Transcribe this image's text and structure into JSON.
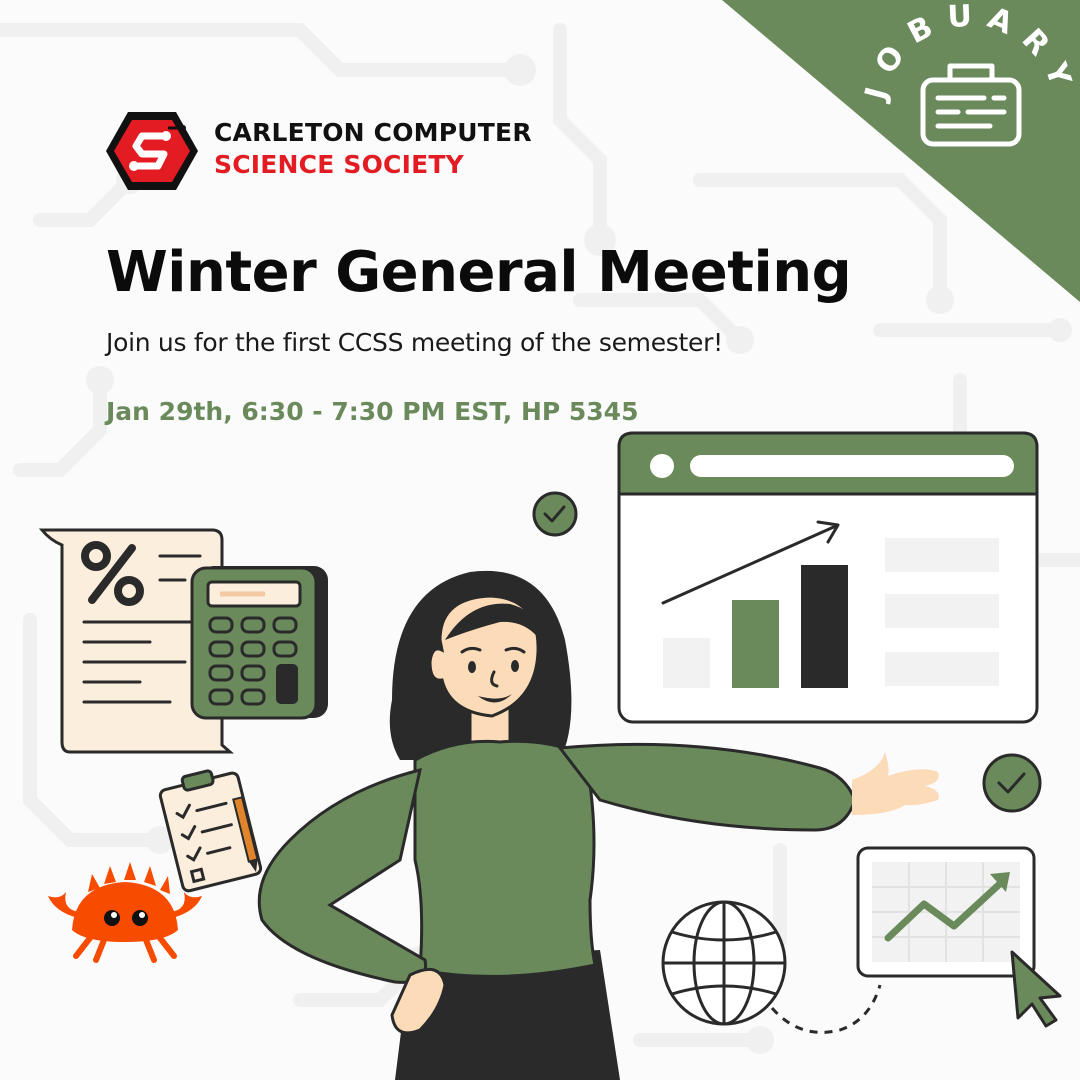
{
  "organization": {
    "name_line1": "CARLETON COMPUTER",
    "name_line2": "SCIENCE SOCIETY",
    "brand_color": "#e31b23"
  },
  "badge": {
    "label": "JOBUARY",
    "icon": "briefcase-icon",
    "background_color": "#6a8a5c"
  },
  "event": {
    "title": "Winter General Meeting",
    "subtitle": "Join us for the first CCSS meeting of the semester!",
    "details": "Jan 29th, 6:30 - 7:30 PM EST, HP 5345",
    "accent_color": "#6a8a5c"
  },
  "illustration": {
    "icons": [
      "percent-document-icon",
      "calculator-icon",
      "clipboard-checklist-icon",
      "crab-mascot-icon",
      "check-circle-icon",
      "bar-chart-window-icon",
      "globe-icon",
      "trend-chart-card-icon",
      "cursor-icon"
    ]
  }
}
